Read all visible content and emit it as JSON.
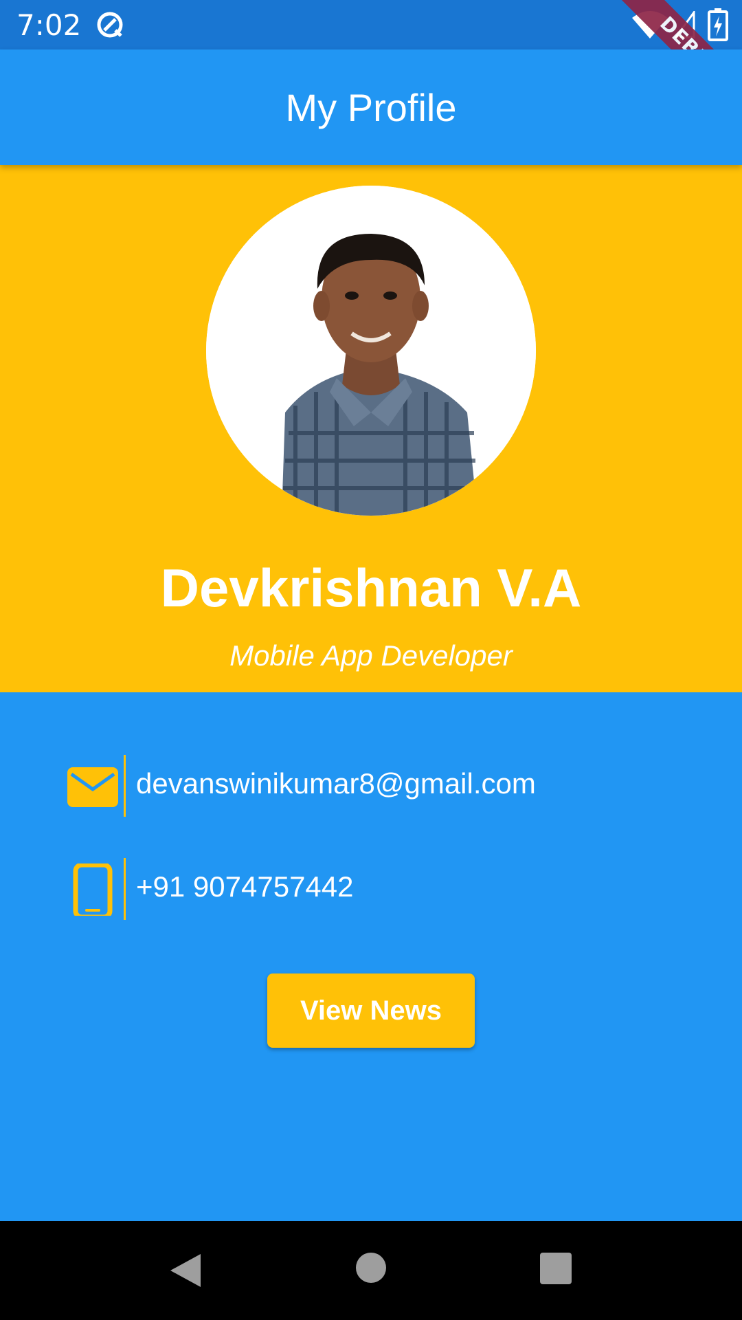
{
  "status_bar": {
    "time": "7:02",
    "icons": [
      "notification-icon",
      "wifi-icon",
      "signal-icon",
      "battery-charging-icon"
    ]
  },
  "debug_banner": "DEBUG",
  "app_bar": {
    "title": "My Profile"
  },
  "profile": {
    "avatar_icon": "profile-photo",
    "name": "Devkrishnan V.A",
    "role": "Mobile App Developer"
  },
  "contact": {
    "email": {
      "icon": "mail-icon",
      "value": "devanswinikumar8@gmail.com"
    },
    "phone": {
      "icon": "phone-icon",
      "value": "+91 9074757442"
    }
  },
  "actions": {
    "view_news": "View News"
  },
  "nav_bar": {
    "icons": [
      "back-icon",
      "home-icon",
      "recents-icon"
    ]
  },
  "colors": {
    "primary": "#2196F3",
    "status_bar": "#1976D2",
    "accent": "#FFC107",
    "debug_banner": "#8E2547",
    "text": "#FFFFFF"
  }
}
